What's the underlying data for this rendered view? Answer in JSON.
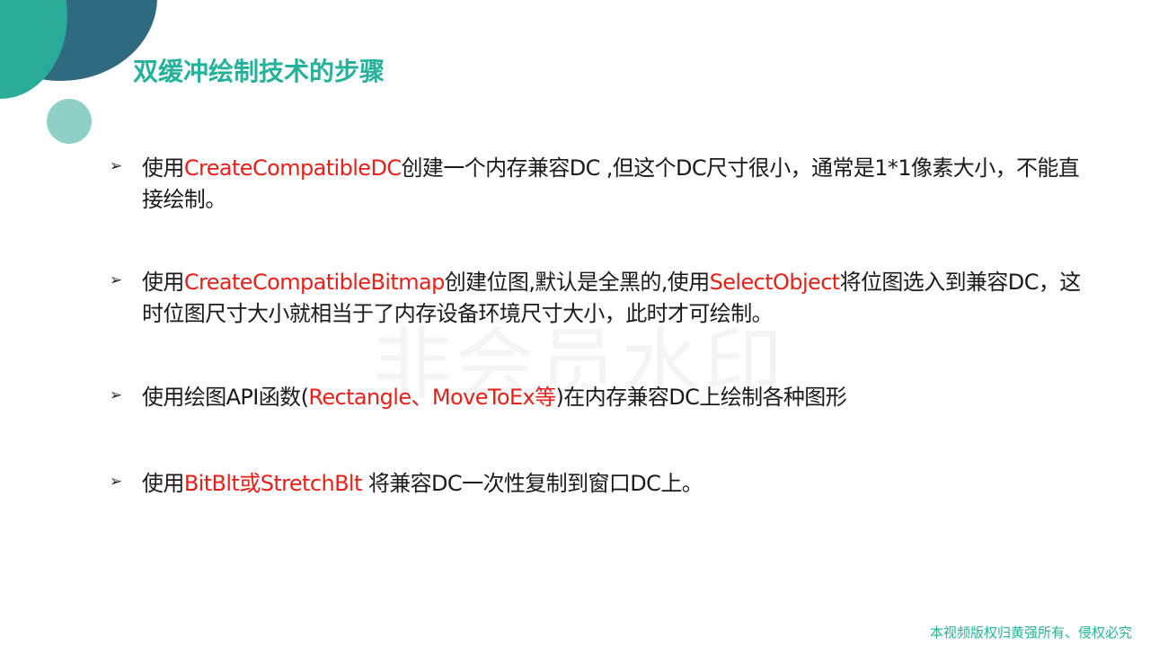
{
  "slide": {
    "title": "双缓冲绘制技术的步骤",
    "watermark": "非会员水印",
    "footer": "本视频版权归黄强所有、侵权必究",
    "colors": {
      "title": "#26b29a",
      "highlight": "#e8201a",
      "text": "#1a1a1a",
      "deco_dark": "#2f6a80",
      "deco_teal": "#2aab9a",
      "deco_light": "#8fd0c6"
    },
    "bullet_icon": "arrowhead-bullet-icon",
    "bullets": [
      {
        "parts": [
          {
            "text": "使用",
            "highlight": false
          },
          {
            "text": "CreateCompatibleDC",
            "highlight": true
          },
          {
            "text": "创建一个内存兼容DC ,但这个DC尺寸很小，通常是1*1像素大小，不能直接绘制。",
            "highlight": false
          }
        ]
      },
      {
        "parts": [
          {
            "text": "使用",
            "highlight": false
          },
          {
            "text": "CreateCompatibleBitmap",
            "highlight": true
          },
          {
            "text": "创建位图,默认是全黑的,使用",
            "highlight": false
          },
          {
            "text": "SelectObject",
            "highlight": true
          },
          {
            "text": "将位图选入到兼容DC，这时位图尺寸大小就相当于了内存设备环境尺寸大小，此时才可绘制。",
            "highlight": false
          }
        ]
      },
      {
        "parts": [
          {
            "text": "使用绘图API函数(",
            "highlight": false
          },
          {
            "text": "Rectangle、MoveToEx等",
            "highlight": true
          },
          {
            "text": ")在内存兼容DC上绘制各种图形",
            "highlight": false
          }
        ]
      },
      {
        "parts": [
          {
            "text": "使用",
            "highlight": false
          },
          {
            "text": "BitBlt或StretchBlt",
            "highlight": true
          },
          {
            "text": " 将兼容DC一次性复制到窗口DC上。",
            "highlight": false
          }
        ]
      }
    ]
  }
}
